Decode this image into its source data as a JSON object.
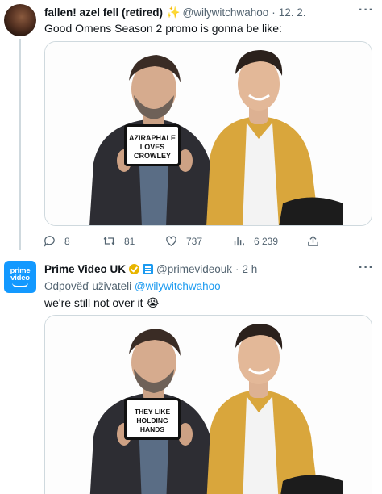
{
  "tweet1": {
    "name": "fallen! azel fell (retired)",
    "emoji": "✨",
    "handle": "@wilywitchwahoo",
    "separator": "·",
    "time": "12. 2.",
    "text": "Good Omens Season 2 promo is gonna be like:",
    "sign_lines": [
      "AZIRAPHALE",
      "LOVES",
      "CROWLEY"
    ],
    "replies": "8",
    "retweets": "81",
    "likes": "737",
    "views": "6 239"
  },
  "tweet2": {
    "name": "Prime Video UK",
    "handle": "@primevideouk",
    "separator": "·",
    "time": "2 h",
    "avatar_lines": [
      "prime",
      "video"
    ],
    "reply_prefix": "Odpověď uživateli",
    "reply_handle": "@wilywitchwahoo",
    "text": "we're still not over it 😭",
    "sign_lines": [
      "THEY LIKE",
      "HOLDING",
      "HANDS"
    ]
  },
  "more_icon": "more-horizontal-icon",
  "colors": {
    "link": "#1d9bf0",
    "muted": "#536471",
    "text": "#0f1419",
    "border": "#cfd9de",
    "brand": "#1399ff"
  }
}
